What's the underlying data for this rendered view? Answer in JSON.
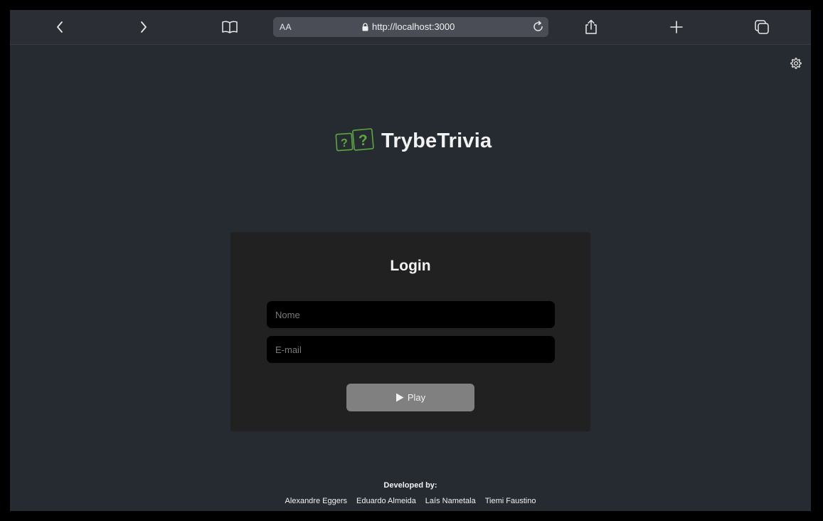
{
  "browser": {
    "url_text": "http://localhost:3000",
    "reader_label": "AA",
    "icons": [
      "back-icon",
      "forward-icon",
      "bookmarks-icon",
      "lock-icon",
      "reload-icon",
      "share-icon",
      "new-tab-icon",
      "tabs-icon"
    ]
  },
  "header": {
    "logo_title": "TrybeTrivia",
    "logo_icon": "question-dice-icon",
    "accent_color": "#5aa840"
  },
  "login": {
    "title": "Login",
    "name_placeholder": "Nome",
    "email_placeholder": "E-mail",
    "play_label": "Play"
  },
  "footer": {
    "title": "Developed by:",
    "developers": [
      "Alexandre Eggers",
      "Eduardo Almeida",
      "Laís Nametala",
      "Tiemi Faustino"
    ]
  }
}
